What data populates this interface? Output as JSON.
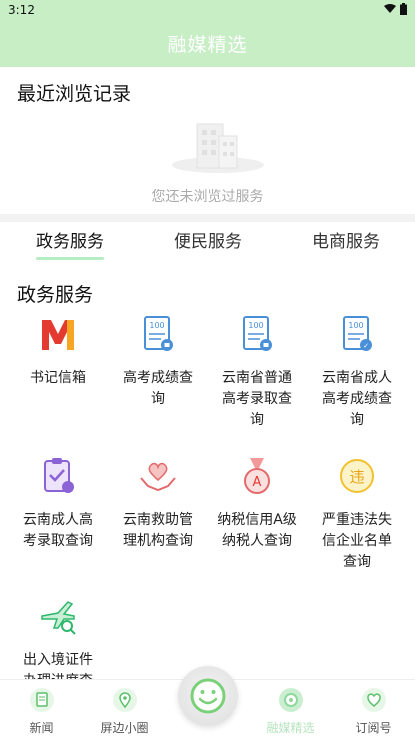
{
  "status_bar": {
    "time": "3:12"
  },
  "app_bar": {
    "title": "融媒精选"
  },
  "recent": {
    "title": "最近浏览记录",
    "empty_text": "您还未浏览过服务"
  },
  "tabs": [
    {
      "label": "政务服务",
      "active": true
    },
    {
      "label": "便民服务",
      "active": false
    },
    {
      "label": "电商服务",
      "active": false
    }
  ],
  "services": {
    "title": "政务服务",
    "items": [
      {
        "label": "书记信箱",
        "icon": "mailbox-logo-icon"
      },
      {
        "label": "高考成绩查询",
        "icon": "score-report-icon"
      },
      {
        "label": "云南省普通高考录取查询",
        "icon": "score-report-icon"
      },
      {
        "label": "云南省成人高考成绩查询",
        "icon": "score-report-icon"
      },
      {
        "label": "云南成人高考录取查询",
        "icon": "clipboard-check-icon"
      },
      {
        "label": "云南救助管理机构查询",
        "icon": "helping-hands-icon"
      },
      {
        "label": "纳税信用A级纳税人查询",
        "icon": "medal-a-icon"
      },
      {
        "label": "严重违法失信企业名单查询",
        "icon": "violation-badge-icon"
      },
      {
        "label": "出入境证件办理进度查",
        "icon": "airplane-search-icon"
      }
    ]
  },
  "bottom_nav": [
    {
      "label": "新闻",
      "icon": "news-icon",
      "active": false
    },
    {
      "label": "屏边小圈",
      "icon": "location-circle-icon",
      "active": false
    },
    {
      "label": "融媒精选",
      "icon": "featured-icon",
      "active": true
    },
    {
      "label": "订阅号",
      "icon": "heart-shield-icon",
      "active": false
    }
  ],
  "colors": {
    "header": "#c7eec5",
    "accent": "#b8ecc2",
    "red": "#e33b2f",
    "blue": "#4a90d9",
    "green": "#2db86b"
  }
}
